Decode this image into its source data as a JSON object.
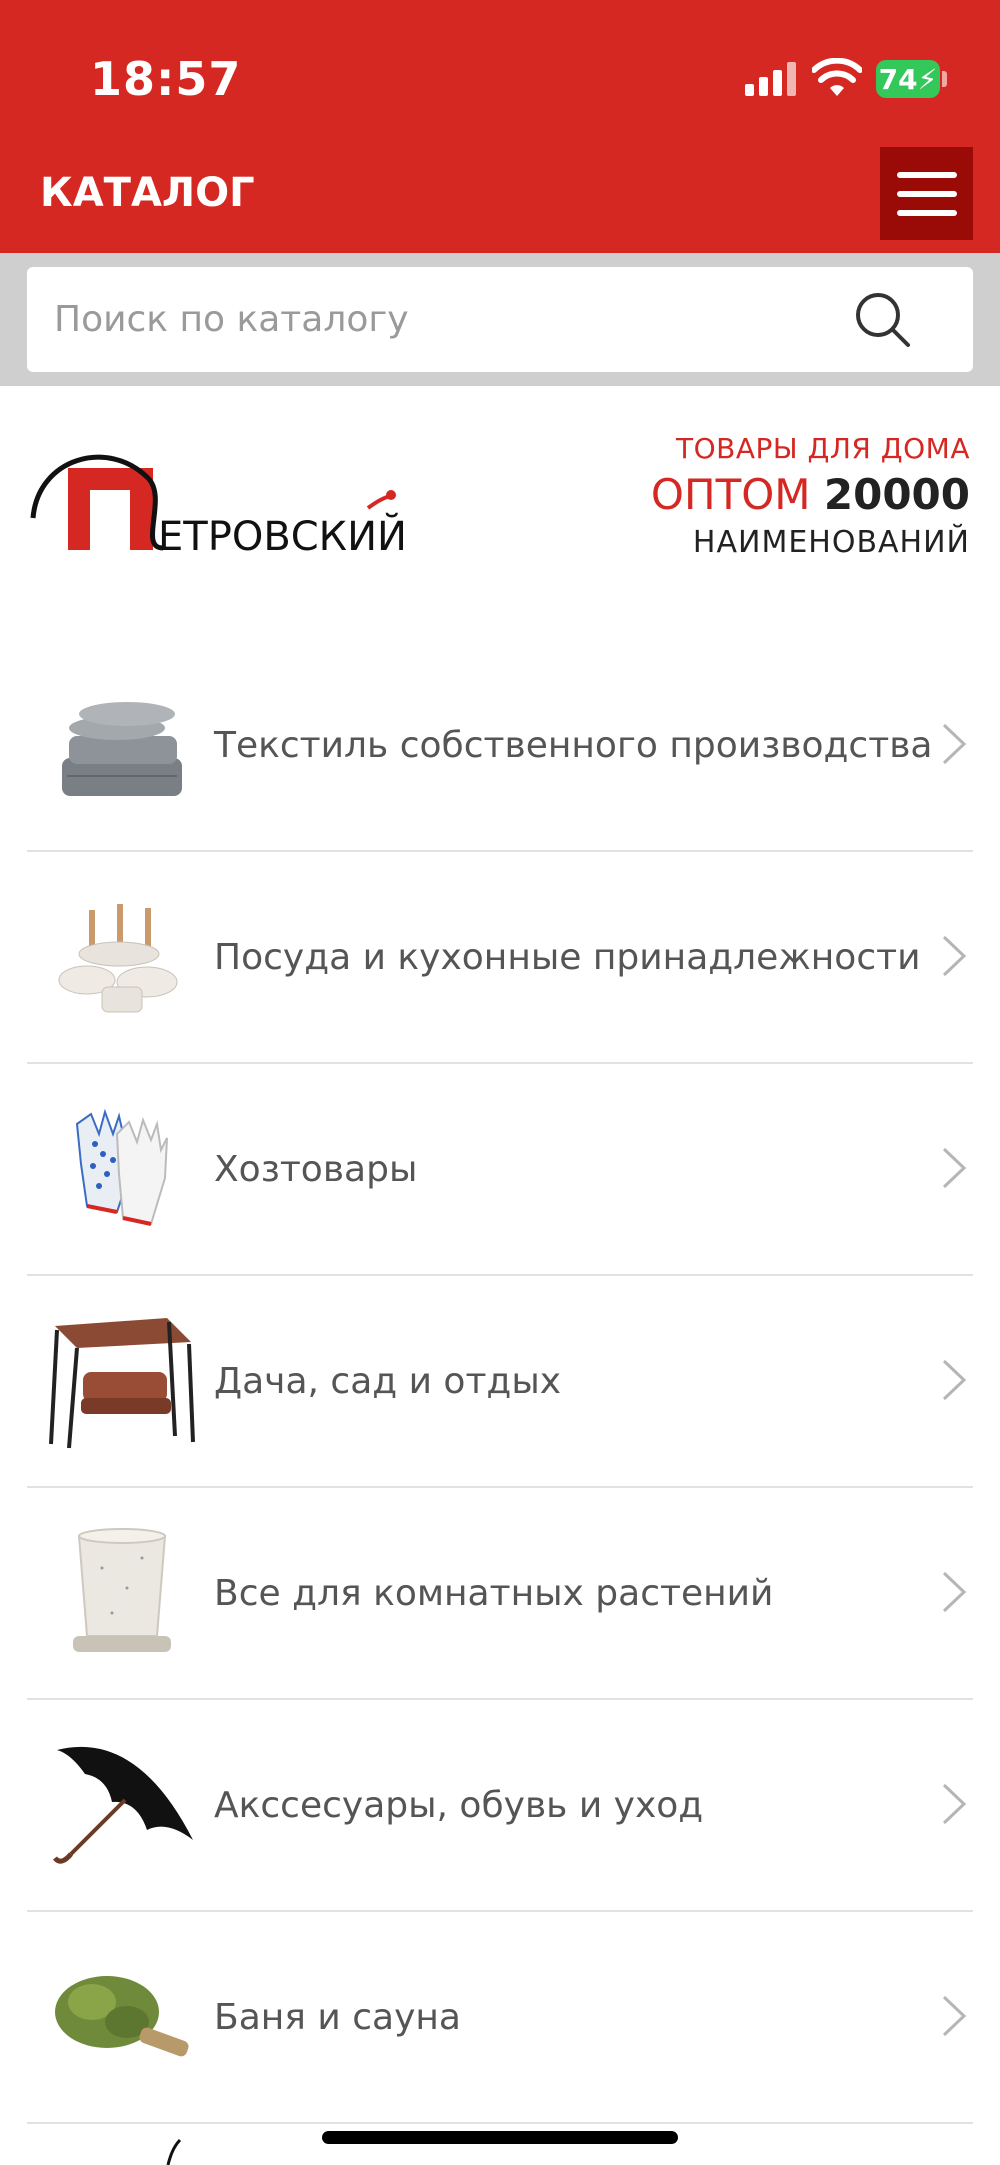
{
  "status_bar": {
    "time": "18:57",
    "battery": "74"
  },
  "header": {
    "title": "КАТАЛОГ",
    "menu_icon": "hamburger-menu-icon"
  },
  "search": {
    "placeholder": "Поиск по каталогу",
    "icon": "search-icon"
  },
  "brand": {
    "logo_text": "ЕТРОВСКИЙ",
    "logo_letter": "П",
    "promo_line1": "ТОВАРЫ ДЛЯ ДОМА",
    "promo_opt": "ОПТОМ",
    "promo_number": "20000",
    "promo_line3": "НАИМЕНОВАНИЙ"
  },
  "catalog": {
    "items": [
      {
        "label": "Текстиль собственного производства",
        "icon": "textile-icon"
      },
      {
        "label": "Посуда и кухонные принадлежности",
        "icon": "cookware-icon"
      },
      {
        "label": "Хозтовары",
        "icon": "gloves-icon"
      },
      {
        "label": "Дача, сад и отдых",
        "icon": "garden-swing-icon"
      },
      {
        "label": "Все для комнатных растений",
        "icon": "flower-pot-icon"
      },
      {
        "label": "Акссесуары, обувь и уход",
        "icon": "umbrella-icon"
      },
      {
        "label": "Баня и сауна",
        "icon": "bath-broom-icon"
      }
    ]
  },
  "colors": {
    "brand_red": "#d62823",
    "menu_dark_red": "#9a0a07",
    "battery_green": "#34c759"
  }
}
